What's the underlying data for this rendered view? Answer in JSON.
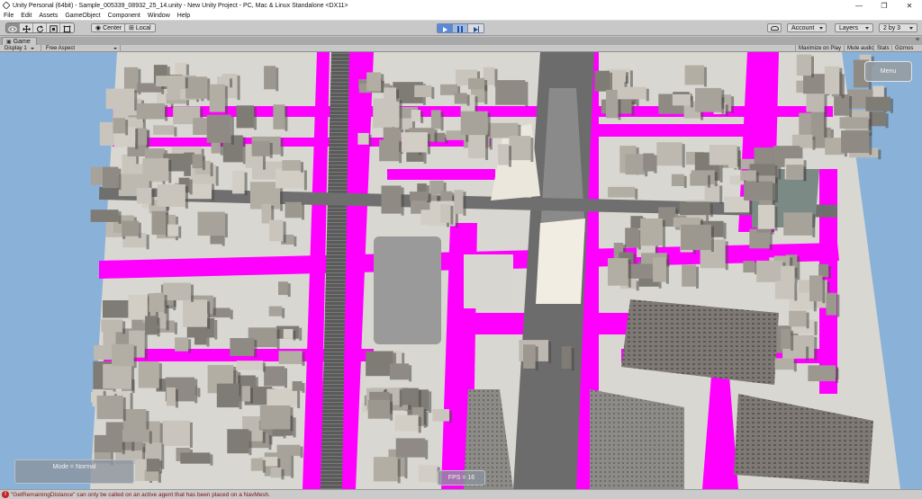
{
  "window": {
    "title": "Unity Personal (64bit) - Sample_005339_08932_25_14.unity - New Unity Project - PC, Mac & Linux Standalone <DX11>",
    "controls": {
      "minimize": "—",
      "maximize": "❐",
      "close": "✕"
    }
  },
  "menubar": {
    "items": [
      "File",
      "Edit",
      "Assets",
      "GameObject",
      "Component",
      "Window",
      "Help"
    ]
  },
  "toolbar": {
    "transform_tools": [
      "hand-tool",
      "move-tool",
      "rotate-tool",
      "scale-tool",
      "rect-tool"
    ],
    "active_tool": "hand-tool",
    "pivot_label": "Center",
    "space_label": "Local",
    "play_state": {
      "playing": true,
      "paused": true
    },
    "account_label": "Account",
    "layers_label": "Layers",
    "layout_label": "2 by 3"
  },
  "game_tab": {
    "tab_label": "Game",
    "display_label": "Display 1",
    "aspect_label": "Free Aspect",
    "toggles": [
      "Maximize on Play",
      "Mute audio",
      "Stats",
      "Gizmos"
    ],
    "panel_menu_glyph": "≡"
  },
  "viewport": {
    "menu_button_label": "Menu",
    "mode_text": "Mode = Normal",
    "fps_text": "FPS = 16",
    "colors": {
      "sky": "#8ab2d8",
      "road_highlight": "#ff00ff",
      "building": "#b9b6ae",
      "road": "#6e6e6e"
    }
  },
  "status": {
    "icon": "error-icon",
    "message": "\"GetRemainingDistance\" can only be called on an active agent that has been placed on a NavMesh."
  }
}
